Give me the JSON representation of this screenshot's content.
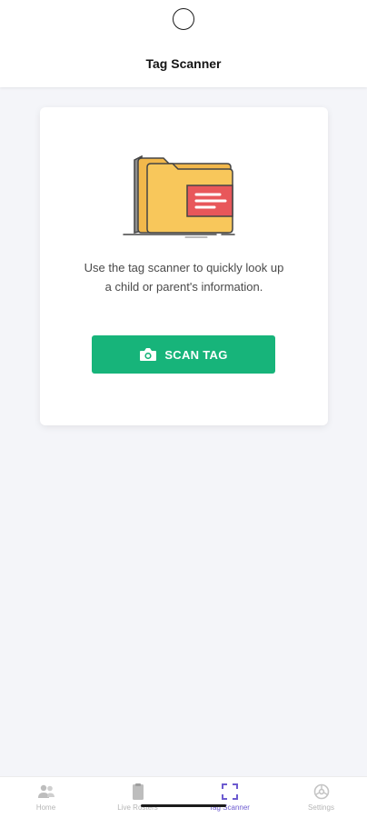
{
  "header": {
    "title": "Tag Scanner"
  },
  "card": {
    "description": "Use the tag scanner to quickly look up a child or parent's information.",
    "scan_button_label": "SCAN TAG",
    "illustration_icon": "folder-with-note-icon"
  },
  "bottom_nav": {
    "items": [
      {
        "label": "Home",
        "icon": "people-icon",
        "active": false
      },
      {
        "label": "Live Rosters",
        "icon": "clipboard-icon",
        "active": false
      },
      {
        "label": "Tag Scanner",
        "icon": "scan-frame-icon",
        "active": true
      },
      {
        "label": "Settings",
        "icon": "settings-icon",
        "active": false
      }
    ]
  },
  "colors": {
    "accent_green": "#17b47a",
    "active_purple": "#6d5bd0",
    "background": "#f4f5f9",
    "folder_yellow": "#f8c75b",
    "note_red": "#e8575a"
  }
}
